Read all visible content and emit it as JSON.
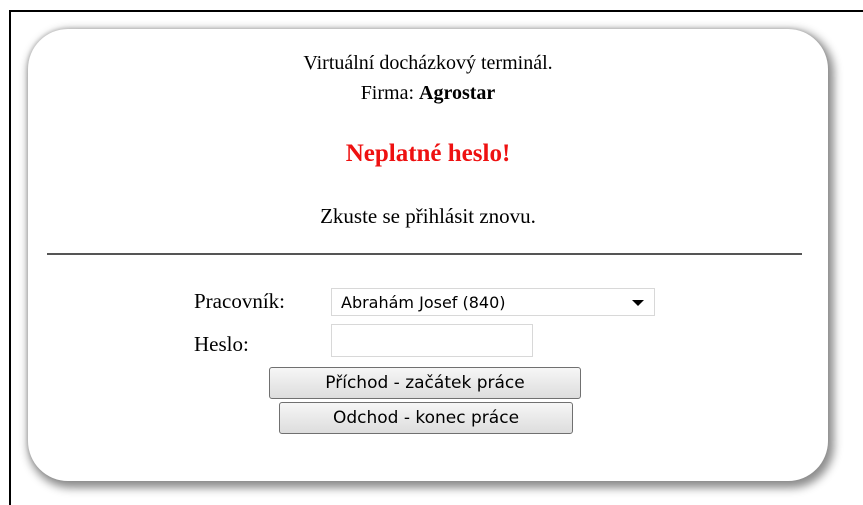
{
  "terminal": {
    "title": "Virtuální docházkový terminál.",
    "firm_label": "Firma:",
    "firm_name": "Agrostar"
  },
  "message": {
    "error": "Neplatné heslo!",
    "retry": "Zkuste se přihlásit znovu."
  },
  "form": {
    "worker_label": "Pracovník:",
    "worker_selected": "Abrahám Josef (840)",
    "password_label": "Heslo:",
    "password_value": "",
    "arrival_button": "Příchod - začátek práce",
    "departure_button": "Odchod - konec práce"
  }
}
